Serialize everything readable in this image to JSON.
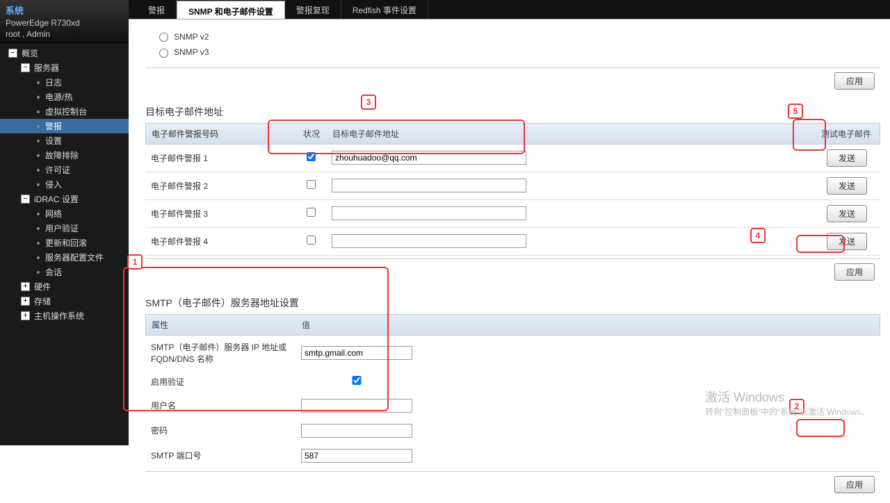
{
  "sidebar": {
    "title": "系统",
    "model": "PowerEdge R730xd",
    "user": "root , Admin",
    "tree": [
      {
        "d": 1,
        "t": "minus",
        "label": "概览"
      },
      {
        "d": 2,
        "t": "minus",
        "label": "服务器"
      },
      {
        "d": 3,
        "t": "dot",
        "label": "日志"
      },
      {
        "d": 3,
        "t": "dot",
        "label": "电源/热"
      },
      {
        "d": 3,
        "t": "dot",
        "label": "虚拟控制台"
      },
      {
        "d": 3,
        "t": "dot",
        "label": "警报",
        "sel": true
      },
      {
        "d": 3,
        "t": "dot",
        "label": "设置"
      },
      {
        "d": 3,
        "t": "dot",
        "label": "故障排除"
      },
      {
        "d": 3,
        "t": "dot",
        "label": "许可证"
      },
      {
        "d": 3,
        "t": "dot",
        "label": "侵入"
      },
      {
        "d": 2,
        "t": "minus",
        "label": "iDRAC 设置"
      },
      {
        "d": 3,
        "t": "dot",
        "label": "网络"
      },
      {
        "d": 3,
        "t": "dot",
        "label": "用户验证"
      },
      {
        "d": 3,
        "t": "dot",
        "label": "更新和回滚"
      },
      {
        "d": 3,
        "t": "dot",
        "label": "服务器配置文件"
      },
      {
        "d": 3,
        "t": "dot",
        "label": "会话"
      },
      {
        "d": 2,
        "t": "plus",
        "label": "硬件"
      },
      {
        "d": 2,
        "t": "plus",
        "label": "存储"
      },
      {
        "d": 2,
        "t": "plus",
        "label": "主机操作系统"
      }
    ]
  },
  "tabs": [
    "警报",
    "SNMP 和电子邮件设置",
    "警报复现",
    "Redfish 事件设置"
  ],
  "snmp": {
    "v2": "SNMP v2",
    "v3": "SNMP v3"
  },
  "btn": {
    "apply": "应用",
    "send": "发送"
  },
  "email": {
    "title": "目标电子邮件地址",
    "col_num": "电子邮件警报号码",
    "col_state": "状况",
    "col_addr": "目标电子邮件地址",
    "col_test": "测试电子邮件",
    "rows": [
      {
        "label": "电子邮件警报 1",
        "checked": true,
        "value": "zhouhuadoo@qq.com"
      },
      {
        "label": "电子邮件警报 2",
        "checked": false,
        "value": ""
      },
      {
        "label": "电子邮件警报 3",
        "checked": false,
        "value": ""
      },
      {
        "label": "电子邮件警报 4",
        "checked": false,
        "value": ""
      }
    ]
  },
  "smtp": {
    "title": "SMTP（电子邮件）服务器地址设置",
    "col_attr": "属性",
    "col_val": "值",
    "f_server": "SMTP（电子邮件）服务器 IP 地址或 FQDN/DNS 名称",
    "v_server": "smtp.gmail.com",
    "f_auth": "启用验证",
    "f_user": "用户名",
    "v_user": "",
    "f_pass": "密码",
    "v_pass": "",
    "f_port": "SMTP 端口号",
    "v_port": "587"
  },
  "watermark": {
    "l1": "激活 Windows",
    "l2": "转到“控制面板”中的“系统”以激活 Windows。"
  },
  "ann": {
    "n1": "1",
    "n2": "2",
    "n3": "3",
    "n4": "4",
    "n5": "5"
  }
}
